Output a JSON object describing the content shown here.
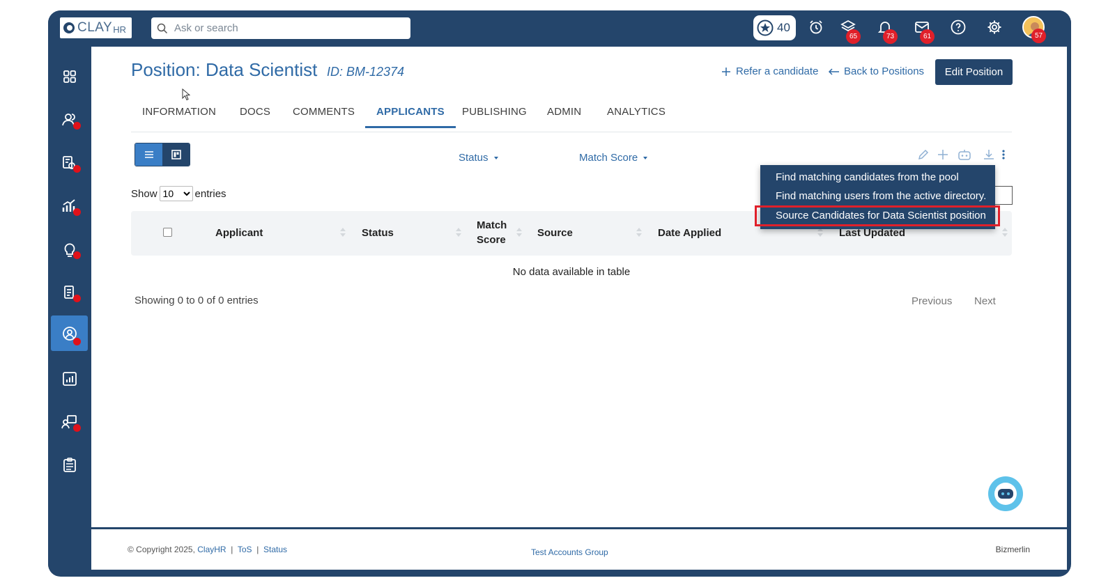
{
  "topbar": {
    "logo_text": "CLAY",
    "logo_suffix": "HR",
    "search_placeholder": "Ask or search",
    "points": "40",
    "badges": {
      "layers": "65",
      "bell": "73",
      "mail": "61",
      "avatar": "57"
    }
  },
  "page": {
    "title": "Position: Data Scientist",
    "id": "ID: BM-12374",
    "refer_label": "Refer a candidate",
    "back_label": "Back to Positions",
    "edit_label": "Edit Position"
  },
  "tabs": [
    "INFORMATION",
    "DOCS",
    "COMMENTS",
    "APPLICANTS",
    "PUBLISHING",
    "ADMIN",
    "ANALYTICS"
  ],
  "active_tab": "APPLICANTS",
  "filters": {
    "status": "Status",
    "match_score": "Match Score"
  },
  "table": {
    "show_label": "Show",
    "entries_label": "entries",
    "page_size": "10",
    "columns": [
      "Applicant",
      "Status",
      "Match",
      "Score",
      "Source",
      "Date Applied",
      "Last Updated"
    ],
    "empty_text": "No data available in table",
    "info": "Showing 0 to 0 of 0 entries",
    "previous": "Previous",
    "next": "Next"
  },
  "menu": {
    "items": [
      "Find matching candidates from the pool",
      "Find matching users from the active directory.",
      "Source Candidates for Data Scientist position"
    ]
  },
  "footer": {
    "copyright": "© Copyright 2025,",
    "brand": "ClayHR",
    "sep": "|",
    "tos": "ToS",
    "status": "Status",
    "group": "Test Accounts Group",
    "company": "Bizmerlin"
  },
  "colors": {
    "navy": "#24456b",
    "accent": "#2f6aa6",
    "badge": "#e0202a",
    "highlight": "#e0202a"
  }
}
